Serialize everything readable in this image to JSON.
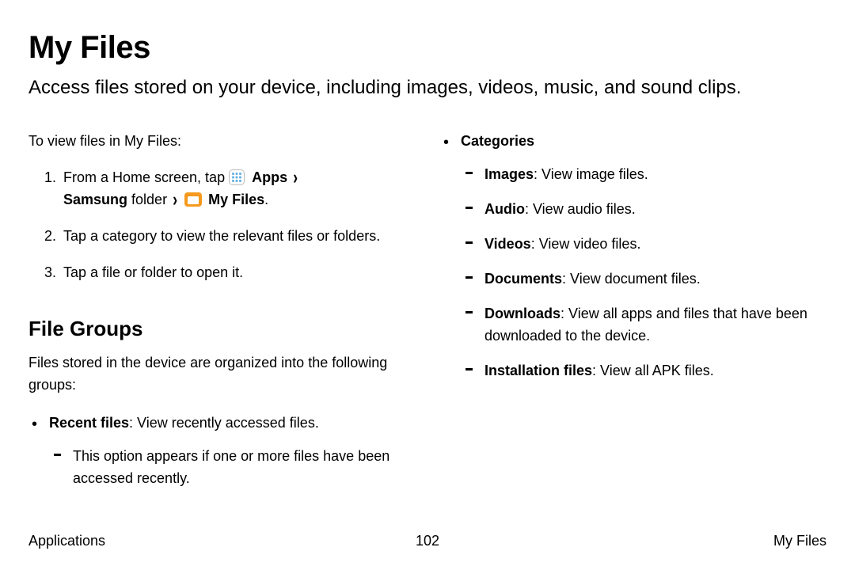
{
  "title": "My Files",
  "subtitle": "Access files stored on your device, including images, videos, music, and sound clips.",
  "left": {
    "intro": "To view files in My Files:",
    "step1_prefix": "From a Home screen, tap ",
    "step1_apps": "Apps",
    "step1_chev": "›",
    "step1_samsung": "Samsung",
    "step1_folder": " folder ",
    "step1_chev2": "›",
    "step1_myfiles": "My Files",
    "step1_period": ".",
    "step2": "Tap a category to view the relevant files or folders.",
    "step3": "Tap a file or folder to open it.",
    "h2": "File Groups",
    "desc": "Files stored in the device are organized into the following groups:",
    "recent_label": "Recent files",
    "recent_text": ": View recently accessed files.",
    "recent_sub": "This option appears if one or more files have been accessed recently."
  },
  "right": {
    "categories_label": "Categories",
    "items": [
      {
        "label": "Images",
        "text": ": View image files."
      },
      {
        "label": "Audio",
        "text": ": View audio files."
      },
      {
        "label": "Videos",
        "text": ": View video files."
      },
      {
        "label": "Documents",
        "text": ": View document files."
      },
      {
        "label": "Downloads",
        "text": ": View all apps and files that have been downloaded to the device."
      },
      {
        "label": "Installation files",
        "text": ": View all APK files."
      }
    ]
  },
  "footer": {
    "left": "Applications",
    "page": "102",
    "right": "My Files"
  }
}
